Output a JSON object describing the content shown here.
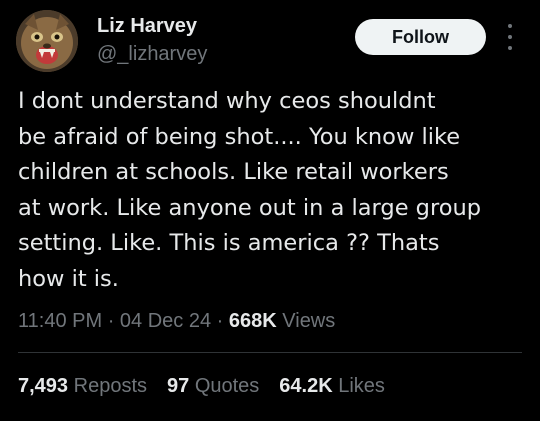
{
  "author": {
    "display_name": "Liz Harvey",
    "handle": "@_lizharvey",
    "avatar_icon": "cat-avatar"
  },
  "actions": {
    "follow_label": "Follow",
    "more_icon": "more-vertical-icon"
  },
  "tweet": {
    "lines": [
      "I dont understand why ceos shouldnt",
      "be afraid of being shot.... You know like",
      "children at schools. Like retail workers",
      "at work. Like anyone out in a large group",
      "setting. Like. This is america ?? Thats",
      "how it is."
    ]
  },
  "meta": {
    "time": "11:40 PM",
    "date": "04 Dec 24",
    "separator": "·",
    "views_count": "668K",
    "views_label": "Views"
  },
  "stats": {
    "reposts_count": "7,493",
    "reposts_label": "Reposts",
    "quotes_count": "97",
    "quotes_label": "Quotes",
    "likes_count": "64.2K",
    "likes_label": "Likes"
  },
  "colors": {
    "background": "#000000",
    "text_primary": "#e7e9ea",
    "text_secondary": "#71767b",
    "follow_bg": "#eff3f4",
    "divider": "#2f3336"
  }
}
